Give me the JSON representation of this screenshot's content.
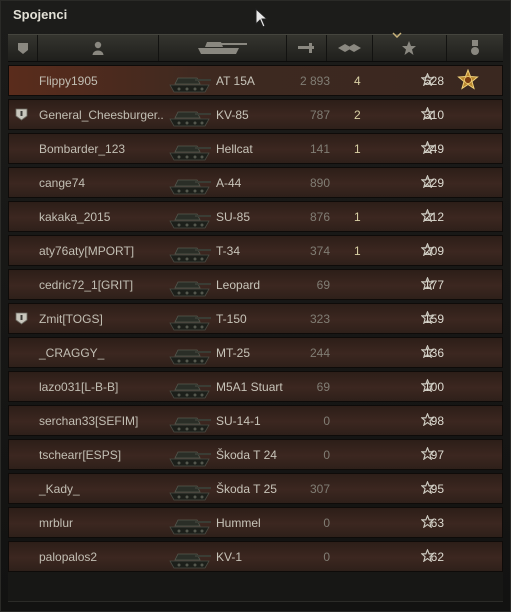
{
  "window": {
    "title": "Spojenci"
  },
  "columns": [
    {
      "name": "platoon",
      "icon": "platoon-icon"
    },
    {
      "name": "player",
      "icon": "player-icon"
    },
    {
      "name": "tank",
      "icon": "tank-icon"
    },
    {
      "name": "damage",
      "icon": "damage-icon"
    },
    {
      "name": "kills",
      "icon": "kills-icon"
    },
    {
      "name": "xp",
      "icon": "star-icon",
      "sorted": "desc"
    },
    {
      "name": "medal",
      "icon": "medal-icon"
    }
  ],
  "rows": [
    {
      "player": "Flippy1905",
      "tank": "AT 15A",
      "damage": "2 893",
      "kills": "4",
      "xp": "528",
      "platoon": false,
      "highlight": true,
      "medal": true
    },
    {
      "player": "General_Cheesburger..",
      "tank": "KV-85",
      "damage": "787",
      "kills": "2",
      "xp": "310",
      "platoon": true
    },
    {
      "player": "Bombarder_123",
      "tank": "Hellcat",
      "damage": "141",
      "kills": "1",
      "xp": "249",
      "platoon": false
    },
    {
      "player": "cange74",
      "tank": "A-44",
      "damage": "890",
      "kills": "",
      "xp": "229",
      "platoon": false
    },
    {
      "player": "kakaka_2015",
      "tank": "SU-85",
      "damage": "876",
      "kills": "1",
      "xp": "212",
      "platoon": false
    },
    {
      "player": "aty76aty[MPORT]",
      "tank": "T-34",
      "damage": "374",
      "kills": "1",
      "xp": "209",
      "platoon": false
    },
    {
      "player": "cedric72_1[GRIT]",
      "tank": "Leopard",
      "damage": "69",
      "kills": "",
      "xp": "177",
      "platoon": false
    },
    {
      "player": "Zmit[TOGS]",
      "tank": "T-150",
      "damage": "323",
      "kills": "",
      "xp": "159",
      "platoon": true
    },
    {
      "player": "_CRAGGY_",
      "tank": "MT-25",
      "damage": "244",
      "kills": "",
      "xp": "136",
      "platoon": false
    },
    {
      "player": "lazo031[L-B-B]",
      "tank": "M5A1 Stuart",
      "damage": "69",
      "kills": "",
      "xp": "100",
      "platoon": false
    },
    {
      "player": "serchan33[SEFIM]",
      "tank": "SU-14-1",
      "damage": "0",
      "kills": "",
      "xp": "98",
      "platoon": false
    },
    {
      "player": "tschearr[ESPS]",
      "tank": "Škoda T 24",
      "damage": "0",
      "kills": "",
      "xp": "97",
      "platoon": false
    },
    {
      "player": "_Kady_",
      "tank": "Škoda T 25",
      "damage": "307",
      "kills": "",
      "xp": "95",
      "platoon": false
    },
    {
      "player": "mrblur",
      "tank": "Hummel",
      "damage": "0",
      "kills": "",
      "xp": "63",
      "platoon": false
    },
    {
      "player": "palopalos2",
      "tank": "KV-1",
      "damage": "0",
      "kills": "",
      "xp": "62",
      "platoon": false
    }
  ],
  "colors": {
    "accent_kills": "#d9d0a5",
    "highlight_row": "#5a2c1c",
    "sort_caret": "#c8b27a"
  }
}
